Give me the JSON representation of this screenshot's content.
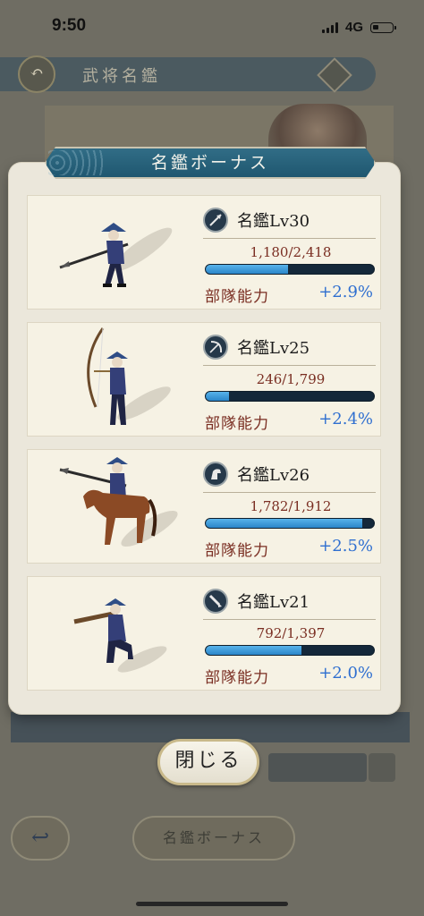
{
  "status_bar": {
    "time": "9:50",
    "network": "4G"
  },
  "modal": {
    "title": "名鑑ボーナス",
    "close_label": "閉じる",
    "items": [
      {
        "unit_type": "spear",
        "icon": "spear-icon",
        "level": "名鑑Lv30",
        "progress_text": "1,180/2,418",
        "progress": 0.488,
        "stat_label": "部隊能力",
        "stat_value": "+2.9%"
      },
      {
        "unit_type": "bow",
        "icon": "bow-icon",
        "level": "名鑑Lv25",
        "progress_text": "246/1,799",
        "progress": 0.137,
        "stat_label": "部隊能力",
        "stat_value": "+2.4%"
      },
      {
        "unit_type": "cavalry",
        "icon": "horse-icon",
        "level": "名鑑Lv26",
        "progress_text": "1,782/1,912",
        "progress": 0.932,
        "stat_label": "部隊能力",
        "stat_value": "+2.5%"
      },
      {
        "unit_type": "gun",
        "icon": "musket-icon",
        "level": "名鑑Lv21",
        "progress_text": "792/1,397",
        "progress": 0.567,
        "stat_label": "部隊能力",
        "stat_value": "+2.0%"
      }
    ]
  },
  "background": {
    "header_title": "武将名鑑",
    "bonus_button_label": "名鑑ボーナス"
  },
  "colors": {
    "bar_fill": "#2b86c9",
    "bar_track": "#14283a",
    "stat_value": "#2f6fd0",
    "label_red": "#7a2e22",
    "title_bg": "#1f5770"
  }
}
